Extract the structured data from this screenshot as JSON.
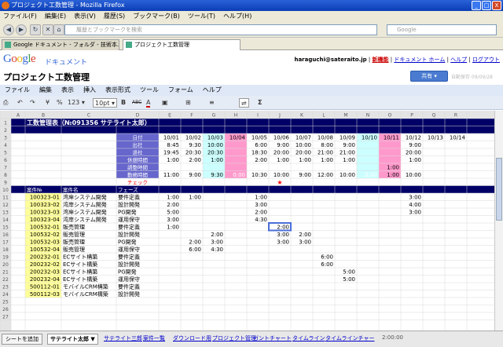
{
  "window": {
    "title": "プロジェクト工数管理 - Mozilla Firefox",
    "min": "_",
    "max": "□",
    "close": "X"
  },
  "browser_menu": [
    "ファイル(F)",
    "編集(E)",
    "表示(V)",
    "履歴(S)",
    "ブックマーク(B)",
    "ツール(T)",
    "ヘルプ(H)"
  ],
  "nav": {
    "url_placeholder": "履歴とブックマークを検索",
    "search_placeholder": "Google"
  },
  "tabs": [
    {
      "label": "Google ドキュメント - フォルダ - 技術本..."
    },
    {
      "label": "プロジェクト工数管理"
    }
  ],
  "gdocs": {
    "logo": "Google",
    "product": "ドキュメント",
    "user": "haraguchi@sateraito.jp",
    "sep": " | ",
    "new": "新機能",
    "home": "ドキュメント ホーム",
    "help": "ヘルプ",
    "logout": "ログアウト"
  },
  "doc": {
    "title": "プロジェクト工数管理",
    "share": "共有 ▾",
    "autosave": "自動保存 09/09/28"
  },
  "doc_menu": [
    "ファイル",
    "編集",
    "表示",
    "挿入",
    "表示形式",
    "ツール",
    "フォーム",
    "ヘルプ"
  ],
  "toolbar": {
    "print": "⎙",
    "undo": "↶",
    "redo": "↷",
    "currency": "¥",
    "percent": "%",
    "format": "123 ▾",
    "fontsize": "10pt ▾",
    "bold": "B",
    "strike": "ABC",
    "textcolor": "A",
    "bgcolor": "▣",
    "borders": "⊞",
    "align": "≡",
    "wrap": "⇌",
    "sum": "Σ"
  },
  "columns": [
    "A",
    "B",
    "C",
    "D",
    "E",
    "F",
    "G",
    "H",
    "I",
    "J",
    "K",
    "L",
    "M",
    "N",
    "O",
    "P",
    "Q",
    "R"
  ],
  "sheet": {
    "title": "工数管理表（№091356 サテライト太郎）",
    "labels": [
      "日付",
      "出社",
      "退社",
      "休憩時間",
      "調整時間",
      "勤務時間",
      "チェック"
    ],
    "dates": [
      "10/01",
      "10/02",
      "10/03",
      "10/04",
      "10/05",
      "10/06",
      "10/07",
      "10/08",
      "10/09",
      "10/10",
      "10/11",
      "10/12",
      "10/13",
      "10/14"
    ],
    "arrive": [
      "8:45",
      "9:30",
      "10:00",
      "",
      "6:00",
      "9:00",
      "10:00",
      "8:00",
      "9:00",
      "",
      "",
      "9:00",
      "",
      ""
    ],
    "leave": [
      "19:45",
      "20:30",
      "20:30",
      "",
      "18:30",
      "20:00",
      "20:00",
      "21:00",
      "21:00",
      "",
      "",
      "20:00",
      "",
      ""
    ],
    "rest": [
      "1:00",
      "2:00",
      "1:00",
      "",
      "2:00",
      "1:00",
      "1:00",
      "1:00",
      "1:00",
      "",
      "",
      "1:00",
      "",
      ""
    ],
    "adjust": [
      "",
      "",
      "",
      "",
      "",
      "",
      "",
      "",
      "",
      "",
      "1:00",
      "",
      "",
      ""
    ],
    "work": [
      "11:00",
      "9:00",
      "9:30",
      "0:00",
      "10:30",
      "10:00",
      "9:00",
      "12:00",
      "10:00",
      "0:00",
      "1:00",
      "10:00",
      "",
      ""
    ],
    "check_mark": "★",
    "check_col": 5,
    "proj_headers": [
      "案件№",
      "案件名",
      "フェーズ"
    ],
    "rows": [
      {
        "no": "100323-01",
        "name": "湾岸システム開発",
        "phase": "要件定義",
        "h": [
          "1:00",
          "1:00",
          "",
          "",
          "1:00",
          "",
          "",
          "",
          "",
          "",
          "",
          "3:00",
          "",
          ""
        ]
      },
      {
        "no": "100323-02",
        "name": "湾岸システム開発",
        "phase": "設計開発",
        "h": [
          "2:00",
          "",
          "",
          "",
          "3:00",
          "",
          "",
          "",
          "",
          "",
          "",
          "4:00",
          "",
          ""
        ]
      },
      {
        "no": "100323-03",
        "name": "湾岸システム開発",
        "phase": "PG開発",
        "h": [
          "5:00",
          "",
          "",
          "",
          "2:00",
          "",
          "",
          "",
          "",
          "",
          "",
          "3:00",
          "",
          ""
        ]
      },
      {
        "no": "100323-04",
        "name": "湾岸システム開発",
        "phase": "運用保守",
        "h": [
          "3:00",
          "",
          "",
          "",
          "4:30",
          "",
          "",
          "",
          "",
          "",
          "",
          "",
          "",
          ""
        ]
      },
      {
        "no": "100532-01",
        "name": "販売管理",
        "phase": "要件定義",
        "h": [
          "1:00",
          "",
          "",
          "",
          "",
          "2:00",
          "",
          "",
          "",
          "",
          "",
          "",
          "",
          ""
        ]
      },
      {
        "no": "100532-02",
        "name": "販売管理",
        "phase": "設計開発",
        "h": [
          "",
          "",
          "2:00",
          "",
          "",
          "3:00",
          "2:00",
          "",
          "",
          "",
          "",
          "",
          "",
          ""
        ]
      },
      {
        "no": "100532-03",
        "name": "販売管理",
        "phase": "PG開発",
        "h": [
          "",
          "2:00",
          "3:00",
          "",
          "",
          "3:00",
          "3:00",
          "",
          "",
          "",
          "",
          "",
          "",
          ""
        ]
      },
      {
        "no": "100532-04",
        "name": "販売管理",
        "phase": "運用保守",
        "h": [
          "",
          "6:00",
          "4:30",
          "",
          "",
          "",
          "",
          "",
          "",
          "",
          "",
          "",
          "",
          ""
        ]
      },
      {
        "no": "200232-01",
        "name": "ECサイト構築",
        "phase": "要件定義",
        "h": [
          "",
          "",
          "",
          "",
          "",
          "",
          "",
          "6:00",
          "",
          "",
          "",
          "",
          "",
          ""
        ]
      },
      {
        "no": "200232-02",
        "name": "ECサイト構築",
        "phase": "設計開発",
        "h": [
          "",
          "",
          "",
          "",
          "",
          "",
          "",
          "6:00",
          "",
          "",
          "",
          "",
          "",
          ""
        ]
      },
      {
        "no": "200232-03",
        "name": "ECサイト構築",
        "phase": "PG開発",
        "h": [
          "",
          "",
          "",
          "",
          "",
          "",
          "",
          "",
          "5:00",
          "",
          "",
          "",
          "",
          ""
        ]
      },
      {
        "no": "200232-04",
        "name": "ECサイト構築",
        "phase": "運用保守",
        "h": [
          "",
          "",
          "",
          "",
          "",
          "",
          "",
          "",
          "5:00",
          "",
          "",
          "",
          "",
          ""
        ]
      },
      {
        "no": "500112-01",
        "name": "モバイルCRM構築",
        "phase": "要件定義",
        "h": [
          "",
          "",
          "",
          "",
          "",
          "",
          "",
          "",
          "",
          "",
          "",
          "",
          "",
          ""
        ]
      },
      {
        "no": "500112-03",
        "name": "モバイルCRM構築",
        "phase": "設計開発",
        "h": [
          "",
          "",
          "",
          "",
          "",
          "",
          "",
          "",
          "",
          "",
          "",
          "",
          "",
          ""
        ]
      }
    ]
  },
  "sheet_bar": {
    "add": "シートを追加",
    "tabs": [
      "サテライト太郎 ▼",
      "サテライト三郎",
      "案件一覧",
      "ダウンロード用",
      "プロジェクト管理",
      "ガントチャート",
      "タイムライン",
      "タイムラインチャー"
    ],
    "sum": "2:00:00"
  },
  "colors": {
    "header_navy": "#000066",
    "label_purple": "#6666cc",
    "cyan": "#ccffff",
    "pink": "#ff99cc",
    "proj_yellow": "#ffff99",
    "check_red": "#ff0000",
    "selected_border": "#4a6ed8"
  }
}
